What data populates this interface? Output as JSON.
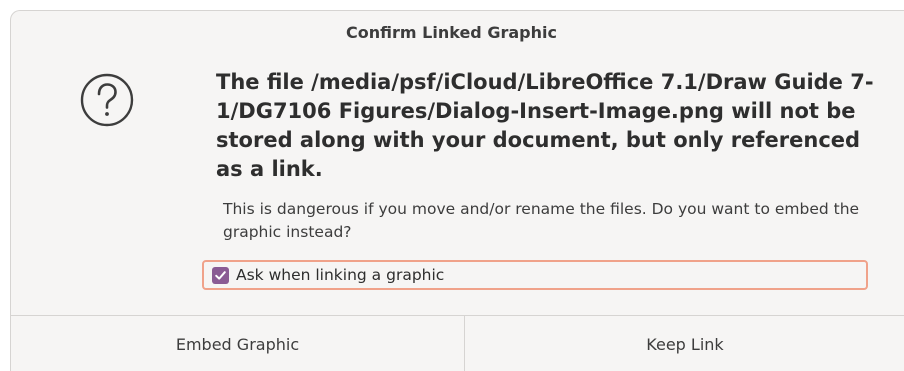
{
  "dialog": {
    "title": "Confirm Linked Graphic",
    "icon": "question-mark-icon",
    "primary_message": "The file /media/psf/iCloud/LibreOffice 7.1/Draw Guide 7-1/DG7106 Figures/Dialog-Insert-Image.png will not be stored along with your document, but only referenced as a link.",
    "secondary_message": "This is dangerous if you move and/or rename the files. Do you want to embed the graphic instead?",
    "checkbox": {
      "label": "Ask when linking a graphic",
      "checked": true,
      "accent_color": "#8a5b94",
      "focus_color": "#f0a28a"
    },
    "buttons": {
      "embed_label": "Embed Graphic",
      "keep_label": "Keep Link"
    }
  }
}
